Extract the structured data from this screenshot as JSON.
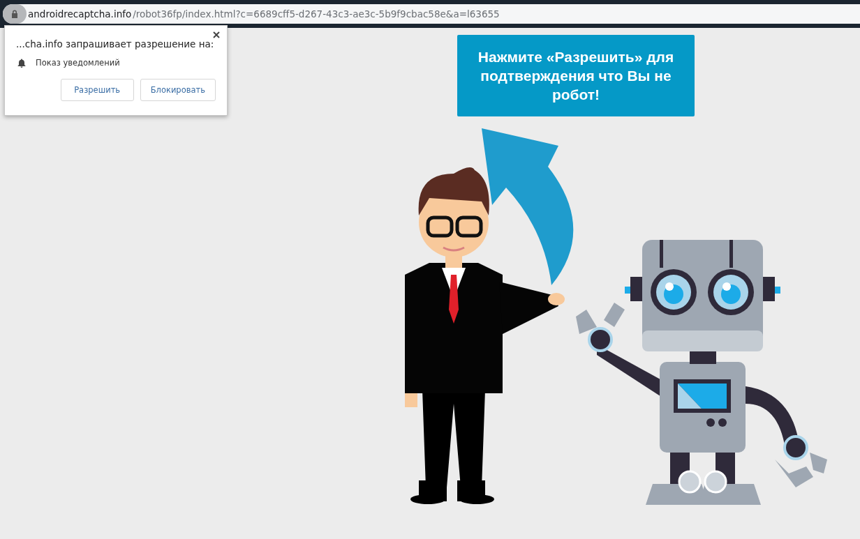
{
  "address_bar": {
    "host": "androidrecaptcha.info",
    "path": "/robot36fp/index.html?c=6689cff5-d267-43c3-ae3c-5b9f9cbac58e&a=l63655"
  },
  "permission_popup": {
    "title": "...cha.info запрашивает разрешение на:",
    "permission": "Показ уведомлений",
    "buttons": [
      "Разрешить",
      "Блокировать"
    ]
  },
  "banner": {
    "text": "Нажмите «Разрешить» для подтверждения что Вы не робот!"
  }
}
